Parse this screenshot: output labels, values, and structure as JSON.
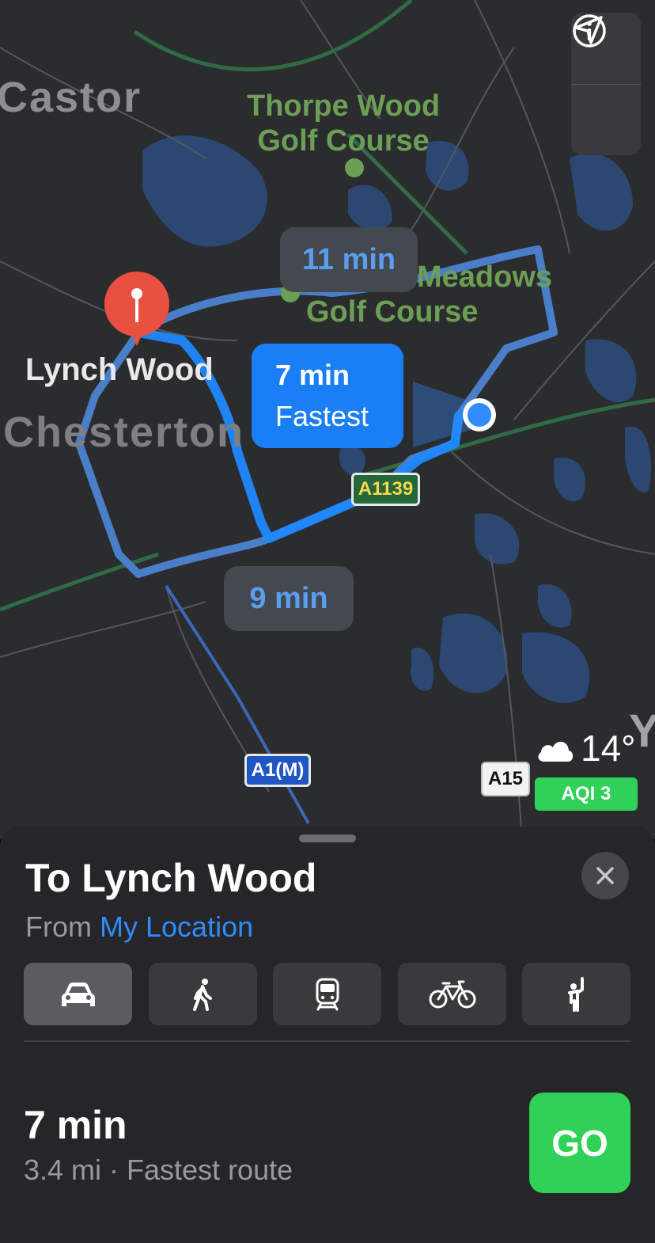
{
  "map": {
    "places": {
      "castor": "Castor",
      "thorpe_line1": "Thorpe Wood",
      "thorpe_line2": "Golf Course",
      "meadows_line1": "Meadows",
      "meadows_line2": "Golf Course",
      "destination": "Lynch Wood",
      "chesterton": "Chesterton",
      "edge_letter": "Y"
    },
    "route_bubbles": {
      "alt_top": "11 min",
      "alt_bottom": "9 min",
      "main_time": "7 min",
      "main_tag": "Fastest"
    },
    "road_shields": {
      "a1139": "A1139",
      "a1m": "A1(M)",
      "a15": "A15"
    },
    "controls": {
      "info_icon": "info-icon",
      "location_icon": "location-arrow-icon"
    },
    "weather": {
      "temp": "14°",
      "aqi": "AQI 3",
      "icon": "cloud-icon"
    },
    "colors": {
      "route_primary": "#1a7ef6",
      "route_alt": "#4b7ec8",
      "pin": "#e8513f",
      "go": "#2fd158"
    }
  },
  "sheet": {
    "title": "To Lynch Wood",
    "from_prefix": "From",
    "from_location": "My Location",
    "modes": [
      {
        "name": "car-icon",
        "selected": true
      },
      {
        "name": "walking-icon",
        "selected": false
      },
      {
        "name": "transit-icon",
        "selected": false
      },
      {
        "name": "bicycle-icon",
        "selected": false
      },
      {
        "name": "ride-share-icon",
        "selected": false
      }
    ],
    "route_time": "7 min",
    "route_desc": "3.4 mi · Fastest route",
    "go_label": "GO"
  }
}
